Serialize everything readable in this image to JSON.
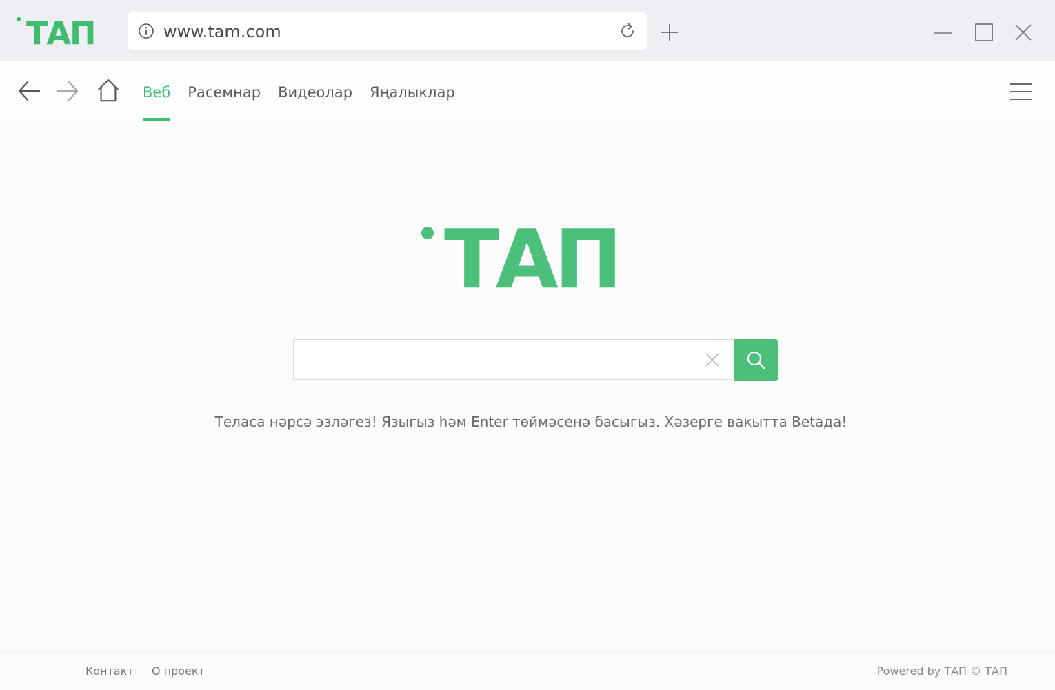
{
  "browser": {
    "url": "www.tam.com",
    "logo_text": "ТАП",
    "accent_color": "#3ebd72"
  },
  "icons": {
    "info": "info-icon",
    "reload": "reload-icon",
    "new_tab": "plus-icon",
    "minimize": "minimize-icon",
    "maximize": "maximize-icon",
    "close": "close-icon",
    "back": "arrow-left-icon",
    "forward": "arrow-right-icon",
    "home": "home-icon",
    "menu": "hamburger-menu-icon",
    "clear": "x-icon",
    "search": "magnifier-icon"
  },
  "nav": {
    "tabs": [
      {
        "label": "Веб",
        "active": true
      },
      {
        "label": "Расемнар",
        "active": false
      },
      {
        "label": "Видеолар",
        "active": false
      },
      {
        "label": "Яңалыклар",
        "active": false
      }
    ]
  },
  "main": {
    "logo_text": "ТАП",
    "search_value": "",
    "search_placeholder": "",
    "hint": "Теласа нәрсә эзләгез! Языгыз һәм Enter төймәсенә басыгыз. Хәзерге вакытта Betaда!"
  },
  "footer": {
    "contact": "Контакт",
    "about": "О проект",
    "powered": "Powered by ТАП © ТАП"
  }
}
